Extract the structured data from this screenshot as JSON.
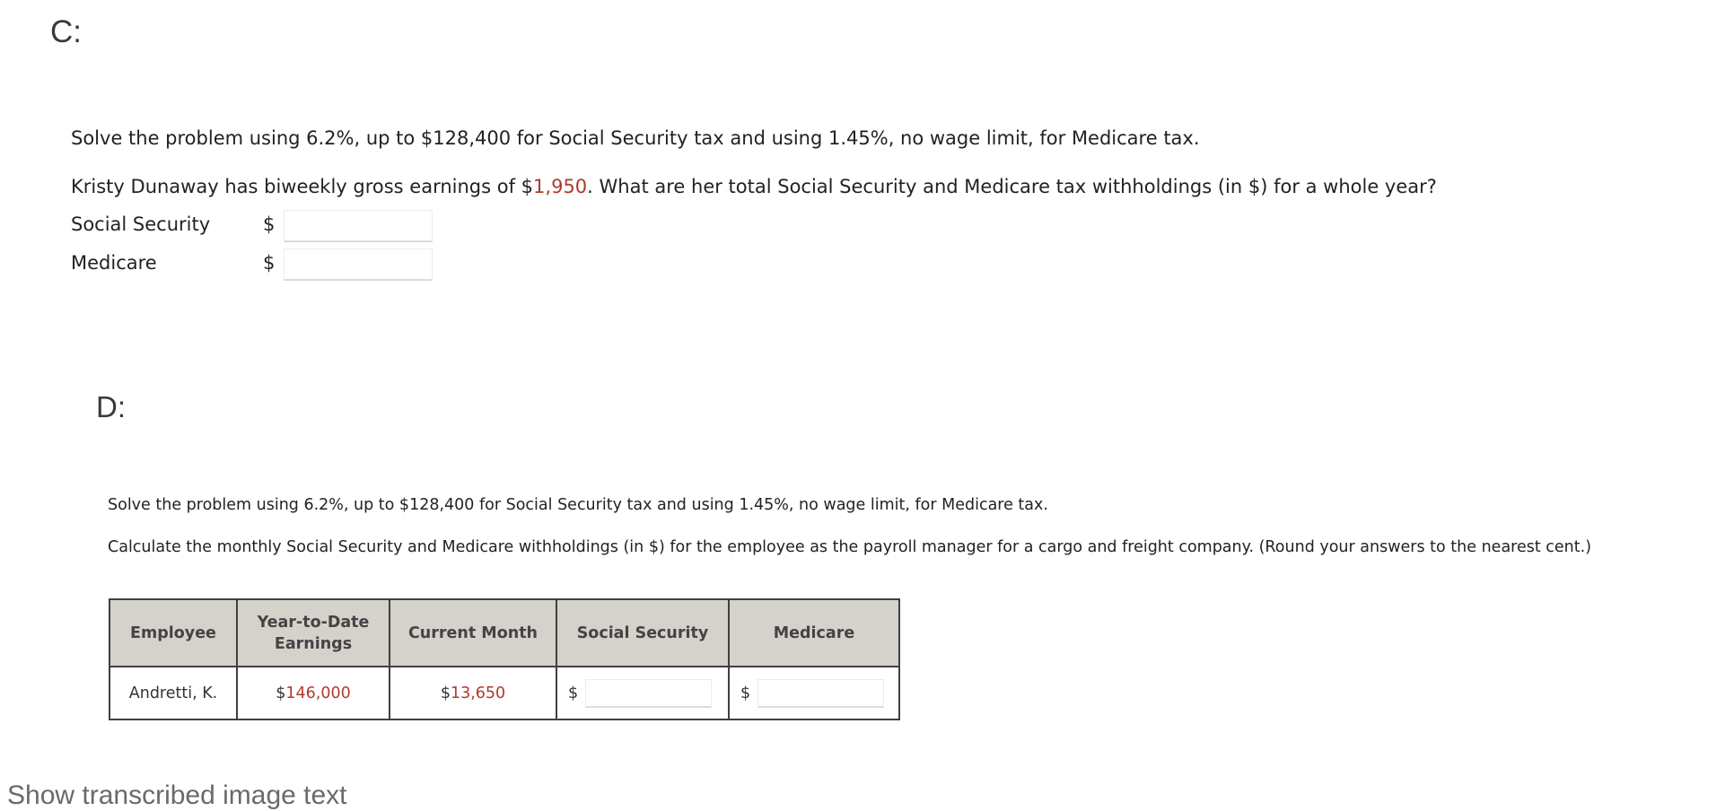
{
  "section_c": {
    "label": "C:",
    "instruction": "Solve the problem using 6.2%, up to $128,400 for Social Security tax and using 1.45%, no wage limit, for Medicare tax.",
    "question_prefix": "Kristy Dunaway has biweekly gross earnings of $",
    "question_value": "1,950",
    "question_suffix": ". What are her total Social Security and Medicare tax withholdings (in $) for a whole year?",
    "fields": [
      {
        "label": "Social Security",
        "currency": "$",
        "value": ""
      },
      {
        "label": "Medicare",
        "currency": "$",
        "value": ""
      }
    ]
  },
  "section_d": {
    "label": "D:",
    "instruction": "Solve the problem using 6.2%, up to $128,400 for Social Security tax and using 1.45%, no wage limit, for Medicare tax.",
    "question": "Calculate the monthly Social Security and Medicare withholdings (in $) for the employee as the payroll manager for a cargo and freight company. (Round your answers to the nearest cent.)",
    "table": {
      "headers": [
        "Employee",
        "Year-to-Date Earnings",
        "Current Month",
        "Social Security",
        "Medicare"
      ],
      "rows": [
        {
          "employee": "Andretti, K.",
          "ytd_currency": "$",
          "ytd_value": "146,000",
          "current_currency": "$",
          "current_value": "13,650",
          "ss_currency": "$",
          "ss_value": "",
          "medicare_currency": "$",
          "medicare_value": ""
        }
      ]
    }
  },
  "footer": {
    "show_transcribed_link": "Show transcribed image text"
  },
  "colors": {
    "highlight_value": "#b03a2e",
    "table_header_bg": "#d5d2cc",
    "table_border": "#3f3f3f"
  }
}
